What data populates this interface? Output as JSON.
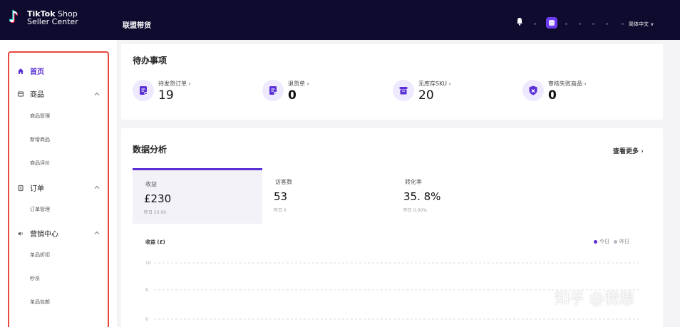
{
  "header": {
    "logo_brand": "TikTok",
    "logo_product": "Shop",
    "logo_subtitle": "Seller Center",
    "nav_title": "联盟带货",
    "language": "简体中文 ∨"
  },
  "sidebar": {
    "items": [
      {
        "label": "首页",
        "icon": "home-icon",
        "active": true
      },
      {
        "label": "商品",
        "icon": "product-icon",
        "expanded": true,
        "children": [
          "商品管理",
          "新增商品",
          "商品评价"
        ]
      },
      {
        "label": "订单",
        "icon": "order-icon",
        "expanded": true,
        "children": [
          "订单管理"
        ]
      },
      {
        "label": "营销中心",
        "icon": "marketing-icon",
        "expanded": true,
        "children": [
          "单品折扣",
          "秒杀",
          "单品包邮"
        ]
      }
    ]
  },
  "todo": {
    "title": "待办事项",
    "items": [
      {
        "label": "待发货订单 ›",
        "value": "19",
        "icon": "pending-shipment-icon"
      },
      {
        "label": "退货单 ›",
        "value": "0",
        "icon": "return-order-icon"
      },
      {
        "label": "无库存SKU ›",
        "value": "20",
        "icon": "out-of-stock-icon"
      },
      {
        "label": "审核失败商品 ›",
        "value": "0",
        "icon": "review-failed-icon"
      }
    ]
  },
  "analytics": {
    "title": "数据分析",
    "view_more": "查看更多 ›",
    "metrics": [
      {
        "label": "收益",
        "value": "£230",
        "sub": "昨日 £0.00",
        "active": true
      },
      {
        "label": "访客数",
        "value": "53",
        "sub": "昨日 0"
      },
      {
        "label": "转化率",
        "value": "35. 8%",
        "sub": "昨日 0.00%"
      }
    ],
    "chart_title": "收益 (£)",
    "legend": [
      "今日",
      "昨日"
    ],
    "legend_colors": [
      "#5a2fd4",
      "#b8b8c4"
    ],
    "y_ticks": [
      "10",
      "8",
      "6"
    ]
  },
  "watermark": "知乎 @我想",
  "colors": {
    "topbar": "#0e0b2e",
    "accent": "#5a2fd4",
    "highlight_border": "#e8473b"
  }
}
